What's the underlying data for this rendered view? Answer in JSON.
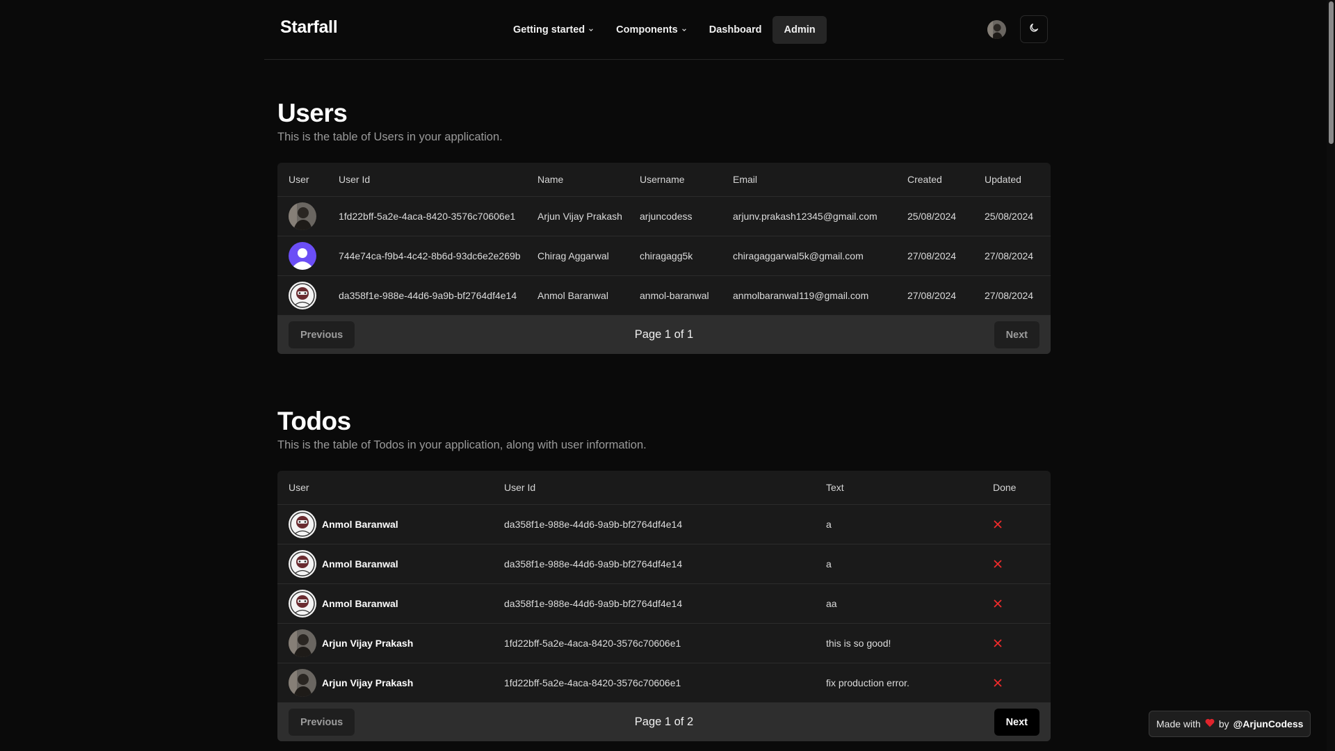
{
  "header": {
    "brand": "Starfall",
    "nav": [
      {
        "label": "Getting started",
        "dropdown": true,
        "active": false
      },
      {
        "label": "Components",
        "dropdown": true,
        "active": false
      },
      {
        "label": "Dashboard",
        "dropdown": false,
        "active": false
      },
      {
        "label": "Admin",
        "dropdown": false,
        "active": true
      }
    ],
    "theme_toggle_icon": "moon-icon"
  },
  "users_section": {
    "title": "Users",
    "subtitle": "This is the table of Users in your application.",
    "columns": [
      "User",
      "User Id",
      "Name",
      "Username",
      "Email",
      "Created",
      "Updated"
    ],
    "rows": [
      {
        "avatar": "photo-avatar",
        "user_id": "1fd22bff-5a2e-4aca-8420-3576c70606e1",
        "name": "Arjun Vijay Prakash",
        "username": "arjuncodess",
        "email": "arjunv.prakash12345@gmail.com",
        "created": "25/08/2024",
        "updated": "25/08/2024"
      },
      {
        "avatar": "default-user-avatar",
        "user_id": "744e74ca-f9b4-4c42-8b6d-93dc6e2e269b",
        "name": "Chirag Aggarwal",
        "username": "chiragagg5k",
        "email": "chiragaggarwal5k@gmail.com",
        "created": "27/08/2024",
        "updated": "27/08/2024"
      },
      {
        "avatar": "robot-avatar",
        "user_id": "da358f1e-988e-44d6-9a9b-bf2764df4e14",
        "name": "Anmol Baranwal",
        "username": "anmol-baranwal",
        "email": "anmolbaranwal119@gmail.com",
        "created": "27/08/2024",
        "updated": "27/08/2024"
      }
    ],
    "pagination": {
      "previous": "Previous",
      "next": "Next",
      "label": "Page 1 of 1",
      "previous_enabled": false,
      "next_enabled": false
    }
  },
  "todos_section": {
    "title": "Todos",
    "subtitle": "This is the table of Todos in your application, along with user information.",
    "columns": [
      "User",
      "User Id",
      "Text",
      "Done"
    ],
    "rows": [
      {
        "avatar": "robot-avatar",
        "name": "Anmol Baranwal",
        "user_id": "da358f1e-988e-44d6-9a9b-bf2764df4e14",
        "text": "a",
        "done": false
      },
      {
        "avatar": "robot-avatar",
        "name": "Anmol Baranwal",
        "user_id": "da358f1e-988e-44d6-9a9b-bf2764df4e14",
        "text": "a",
        "done": false
      },
      {
        "avatar": "robot-avatar",
        "name": "Anmol Baranwal",
        "user_id": "da358f1e-988e-44d6-9a9b-bf2764df4e14",
        "text": "aa",
        "done": false
      },
      {
        "avatar": "photo-avatar",
        "name": "Arjun Vijay Prakash",
        "user_id": "1fd22bff-5a2e-4aca-8420-3576c70606e1",
        "text": "this is so good!",
        "done": false
      },
      {
        "avatar": "photo-avatar",
        "name": "Arjun Vijay Prakash",
        "user_id": "1fd22bff-5a2e-4aca-8420-3576c70606e1",
        "text": "fix production error.",
        "done": false
      }
    ],
    "pagination": {
      "previous": "Previous",
      "next": "Next",
      "label": "Page 1 of 2",
      "previous_enabled": false,
      "next_enabled": true
    }
  },
  "badge": {
    "made_with": "Made with",
    "by": "by",
    "handle": "@ArjunCodess",
    "heart_color": "#e0242c"
  },
  "colors": {
    "background": "#0a0a0a",
    "card": "#1a1a1a",
    "pager": "#2e2e2e",
    "danger": "#ef2b2b",
    "default_avatar": "#6b4ef6"
  }
}
